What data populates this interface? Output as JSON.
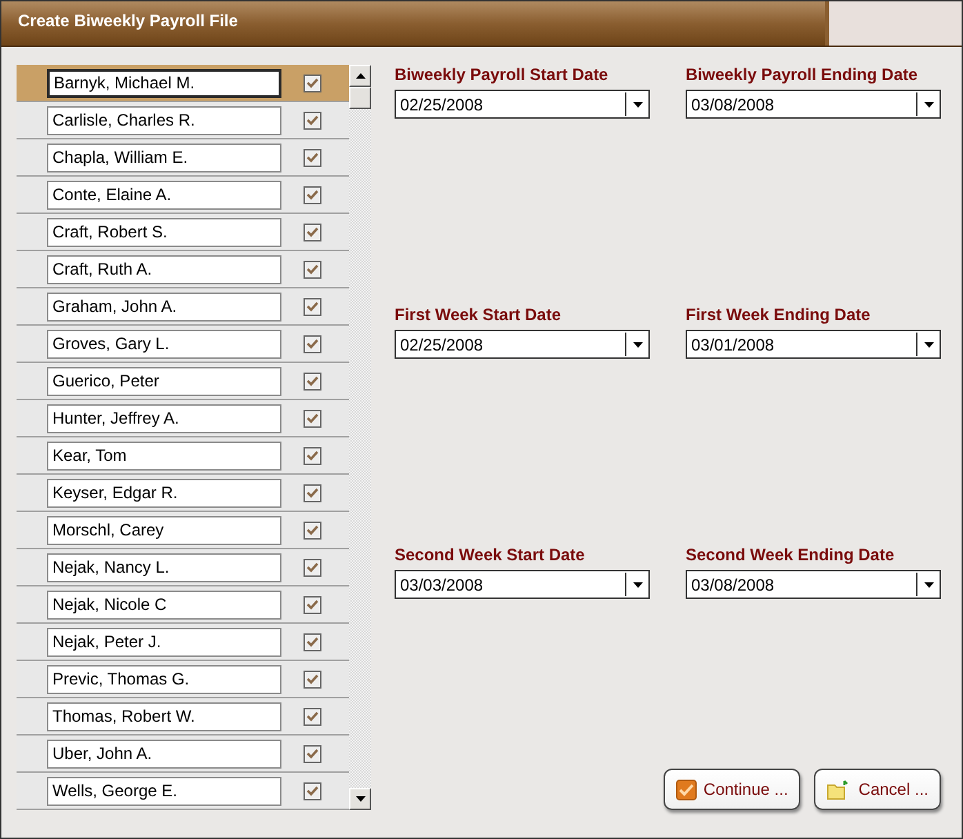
{
  "window": {
    "title": "Create Biweekly Payroll File"
  },
  "employees": [
    {
      "name": "Barnyk, Michael M.",
      "checked": true,
      "selected": true
    },
    {
      "name": "Carlisle, Charles R.",
      "checked": true,
      "selected": false
    },
    {
      "name": "Chapla, William E.",
      "checked": true,
      "selected": false
    },
    {
      "name": "Conte, Elaine A.",
      "checked": true,
      "selected": false
    },
    {
      "name": "Craft, Robert S.",
      "checked": true,
      "selected": false
    },
    {
      "name": "Craft, Ruth A.",
      "checked": true,
      "selected": false
    },
    {
      "name": "Graham, John A.",
      "checked": true,
      "selected": false
    },
    {
      "name": "Groves, Gary L.",
      "checked": true,
      "selected": false
    },
    {
      "name": "Guerico, Peter",
      "checked": true,
      "selected": false
    },
    {
      "name": "Hunter, Jeffrey A.",
      "checked": true,
      "selected": false
    },
    {
      "name": "Kear, Tom",
      "checked": true,
      "selected": false
    },
    {
      "name": "Keyser, Edgar R.",
      "checked": true,
      "selected": false
    },
    {
      "name": "Morschl, Carey",
      "checked": true,
      "selected": false
    },
    {
      "name": "Nejak, Nancy L.",
      "checked": true,
      "selected": false
    },
    {
      "name": "Nejak, Nicole C",
      "checked": true,
      "selected": false
    },
    {
      "name": "Nejak, Peter J.",
      "checked": true,
      "selected": false
    },
    {
      "name": "Previc, Thomas G.",
      "checked": true,
      "selected": false
    },
    {
      "name": "Thomas, Robert W.",
      "checked": true,
      "selected": false
    },
    {
      "name": "Uber, John A.",
      "checked": true,
      "selected": false
    },
    {
      "name": "Wells, George E.",
      "checked": true,
      "selected": false
    }
  ],
  "date_groups": [
    [
      {
        "label": "Biweekly Payroll Start Date",
        "value": "02/25/2008"
      },
      {
        "label": "Biweekly Payroll Ending Date",
        "value": "03/08/2008"
      }
    ],
    [
      {
        "label": "First Week Start Date",
        "value": "02/25/2008"
      },
      {
        "label": "First Week Ending Date",
        "value": "03/01/2008"
      }
    ],
    [
      {
        "label": "Second Week Start Date",
        "value": "03/03/2008"
      },
      {
        "label": "Second Week Ending Date",
        "value": "03/08/2008"
      }
    ]
  ],
  "buttons": [
    {
      "kind": "continue",
      "label": "Continue ..."
    },
    {
      "kind": "cancel",
      "label": "Cancel ..."
    }
  ]
}
